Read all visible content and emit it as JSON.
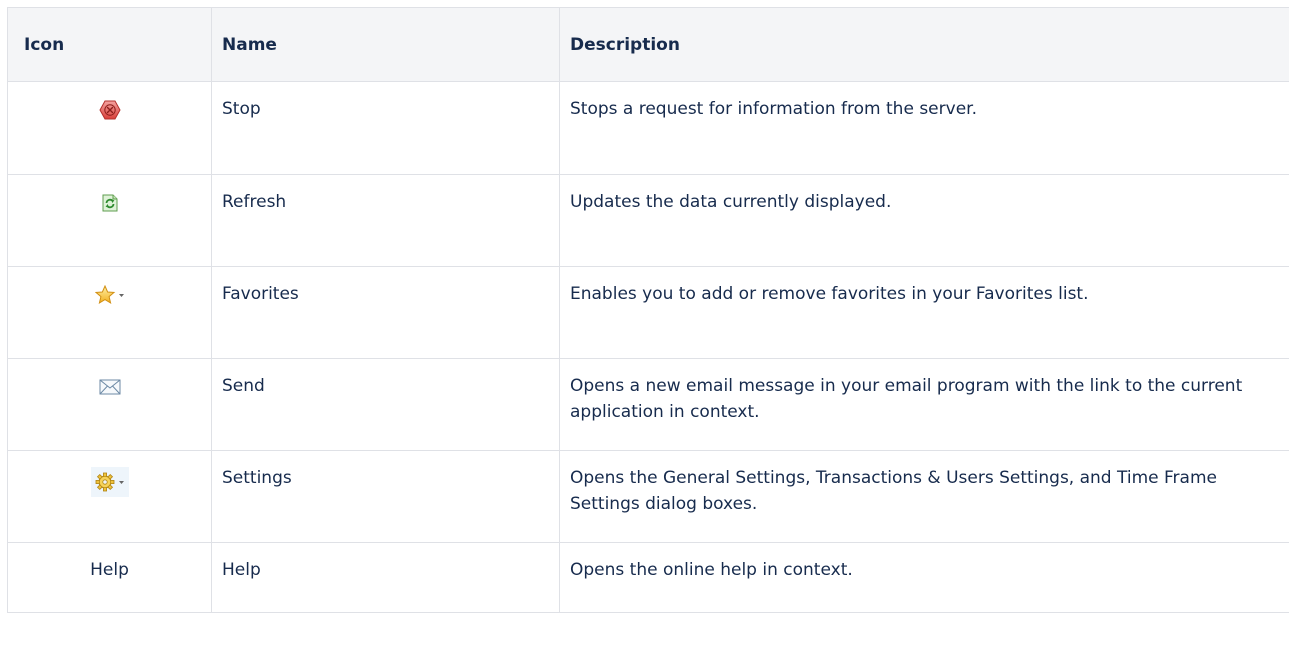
{
  "table": {
    "headers": {
      "icon": "Icon",
      "name": "Name",
      "description": "Description"
    },
    "rows": [
      {
        "icon": "stop-icon",
        "icon_text": "",
        "name": "Stop",
        "description": "Stops a request for information from the server."
      },
      {
        "icon": "refresh-icon",
        "icon_text": "",
        "name": "Refresh",
        "description": "Updates the data currently displayed."
      },
      {
        "icon": "favorites-star-dropdown-icon",
        "icon_text": "",
        "name": "Favorites",
        "description": "Enables you to add or remove favorites in your Favorites list."
      },
      {
        "icon": "send-envelope-icon",
        "icon_text": "",
        "name": "Send",
        "description": "Opens a new email message in your email program with the link to the current application in context."
      },
      {
        "icon": "settings-gear-dropdown-icon",
        "icon_text": "",
        "name": "Settings",
        "description": "Opens the General Settings, Transactions & Users Settings, and Time Frame Settings dialog boxes."
      },
      {
        "icon": "text",
        "icon_text": "Help",
        "name": "Help",
        "description": "Opens the online help in context."
      }
    ]
  },
  "colors": {
    "header_bg": "#f4f5f7",
    "border": "#dfe1e6",
    "text": "#172b4d",
    "stop_red": "#e0443e",
    "refresh_green": "#3aa53a",
    "star_gold": "#f6c32c",
    "settings_bg": "#eef5fb"
  }
}
